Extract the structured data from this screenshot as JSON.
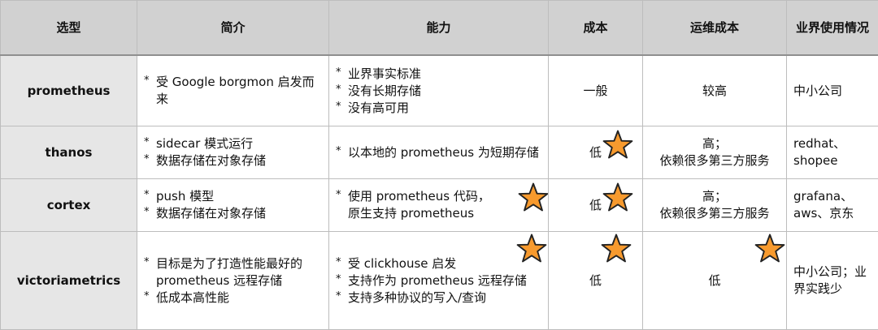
{
  "header": {
    "col1": "选型",
    "col2": "简介",
    "col3": "能力",
    "col4": "成本",
    "col5": "运维成本",
    "col6": "业界使用情况"
  },
  "rows": [
    {
      "name": "prometheus",
      "intro": [
        "受 Google borgmon 启发而来"
      ],
      "ability": [
        "业界事实标准",
        "没有长期存储",
        "没有高可用"
      ],
      "cost": "一般",
      "ops_cost": "较高",
      "usage": "中小公司"
    },
    {
      "name": "thanos",
      "intro": [
        "sidecar 模式运行",
        "数据存储在对象存储"
      ],
      "ability": [
        "以本地的 prometheus 为短期存储"
      ],
      "cost": "低",
      "ops_cost_line1": "高；",
      "ops_cost_line2": "依赖很多第三方服务",
      "usage": "redhat、shopee"
    },
    {
      "name": "cortex",
      "intro": [
        "push 模型",
        "数据存储在对象存储"
      ],
      "ability_line1": "使用 prometheus 代码，",
      "ability_line2": "原生支持 prometheus",
      "cost": "低",
      "ops_cost_line1": "高；",
      "ops_cost_line2": "依赖很多第三方服务",
      "usage": "grafana、aws、京东"
    },
    {
      "name": "victoriametrics",
      "intro": [
        "目标是为了打造性能最好的 prometheus 远程存储",
        "低成本高性能"
      ],
      "ability": [
        "受 clickhouse 启发",
        "支持作为 prometheus 远程存储",
        "支持多种协议的写入/查询"
      ],
      "cost": "低",
      "ops_cost": "低",
      "usage": "中小公司；业界实践少"
    }
  ],
  "colors": {
    "header_bg": "#d1d1d1",
    "name_bg": "#e6e6e6",
    "star_fill": "#f79a2e",
    "star_stroke": "#222222"
  },
  "icons": {
    "highlight": "star-icon"
  }
}
